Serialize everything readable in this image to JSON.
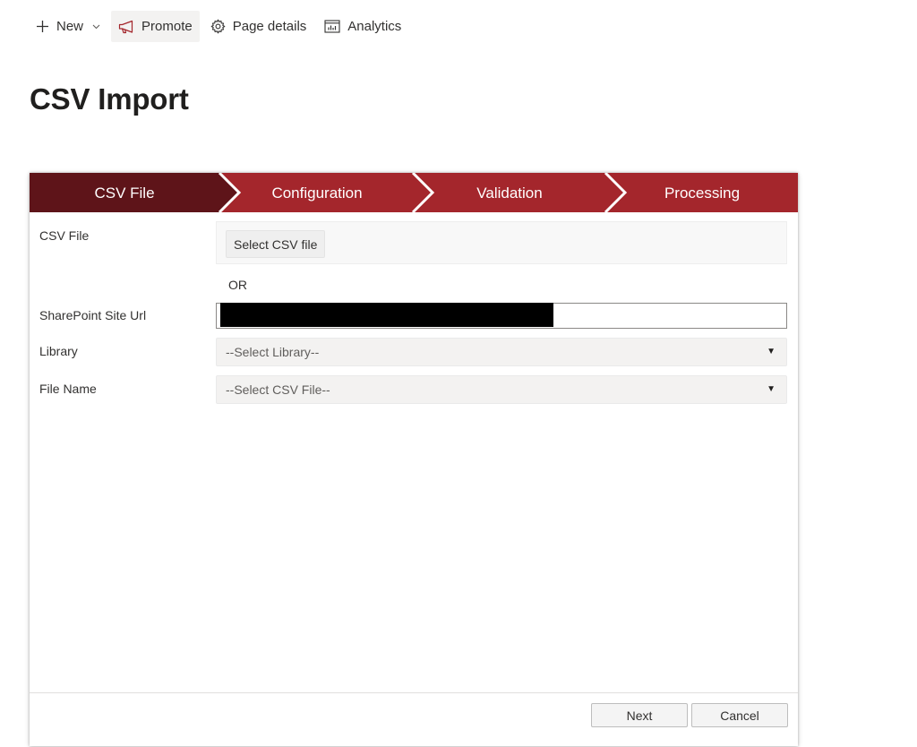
{
  "command_bar": {
    "new_label": "New",
    "promote_label": "Promote",
    "page_details_label": "Page details",
    "analytics_label": "Analytics"
  },
  "page_title": "CSV Import",
  "wizard": {
    "steps": [
      {
        "label": "CSV File",
        "active": true
      },
      {
        "label": "Configuration",
        "active": false
      },
      {
        "label": "Validation",
        "active": false
      },
      {
        "label": "Processing",
        "active": false
      }
    ],
    "colors": {
      "active": "#5e1419",
      "inactive": "#a4262c"
    }
  },
  "form": {
    "csv_file_label": "CSV File",
    "select_file_button": "Select CSV file",
    "or_text": "OR",
    "site_url_label": "SharePoint Site Url",
    "site_url_value": "",
    "library_label": "Library",
    "library_selected": "--Select Library--",
    "file_name_label": "File Name",
    "file_name_selected": "--Select CSV File--"
  },
  "footer": {
    "next_label": "Next",
    "cancel_label": "Cancel"
  },
  "icons": {
    "new": "plus-icon",
    "new_menu": "chevron-down-icon",
    "promote": "megaphone-icon",
    "page_details": "gear-icon",
    "analytics": "chart-icon",
    "dropdown": "caret-down-icon"
  }
}
